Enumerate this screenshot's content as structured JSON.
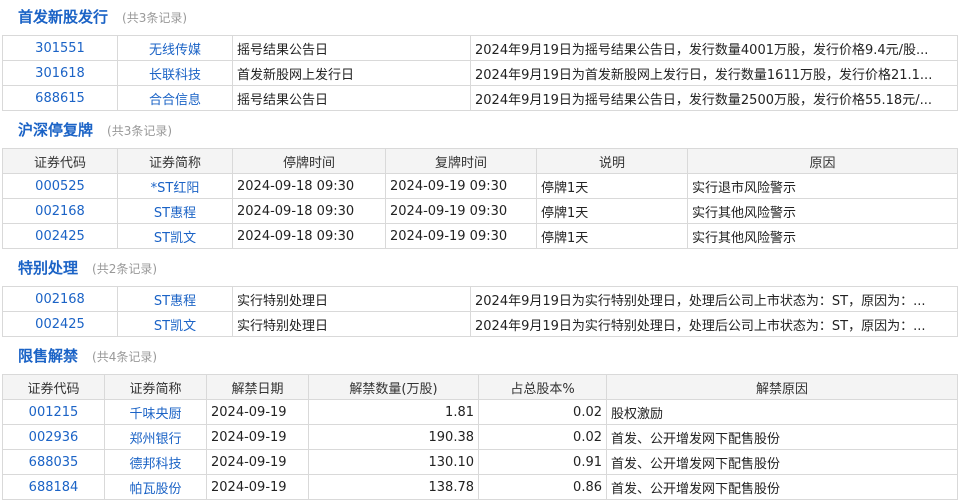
{
  "sec1": {
    "title": "首发新股发行",
    "count": "(共3条记录)",
    "rows": [
      [
        "301551",
        "无线传媒",
        "摇号结果公告日",
        "2024年9月19日为摇号结果公告日，发行数量4001万股，发行价格9.4元/股..."
      ],
      [
        "301618",
        "长联科技",
        "首发新股网上发行日",
        "2024年9月19日为首发新股网上发行日，发行数量1611万股，发行价格21.1..."
      ],
      [
        "688615",
        "合合信息",
        "摇号结果公告日",
        "2024年9月19日为摇号结果公告日，发行数量2500万股，发行价格55.18元/..."
      ]
    ]
  },
  "sec2": {
    "title": "沪深停复牌",
    "count": "(共3条记录)",
    "headers": [
      "证券代码",
      "证券简称",
      "停牌时间",
      "复牌时间",
      "说明",
      "原因"
    ],
    "rows": [
      [
        "000525",
        "*ST红阳",
        "2024-09-18 09:30",
        "2024-09-19 09:30",
        "停牌1天",
        "实行退市风险警示"
      ],
      [
        "002168",
        "ST惠程",
        "2024-09-18 09:30",
        "2024-09-19 09:30",
        "停牌1天",
        "实行其他风险警示"
      ],
      [
        "002425",
        "ST凯文",
        "2024-09-18 09:30",
        "2024-09-19 09:30",
        "停牌1天",
        "实行其他风险警示"
      ]
    ]
  },
  "sec3": {
    "title": "特别处理",
    "count": "(共2条记录)",
    "rows": [
      [
        "002168",
        "ST惠程",
        "实行特别处理日",
        "2024年9月19日为实行特别处理日，处理后公司上市状态为：ST，原因为：..."
      ],
      [
        "002425",
        "ST凯文",
        "实行特别处理日",
        "2024年9月19日为实行特别处理日，处理后公司上市状态为：ST，原因为：..."
      ]
    ]
  },
  "sec4": {
    "title": "限售解禁",
    "count": "(共4条记录)",
    "headers": [
      "证券代码",
      "证券简称",
      "解禁日期",
      "解禁数量(万股)",
      "占总股本%",
      "解禁原因"
    ],
    "rows": [
      [
        "001215",
        "千味央厨",
        "2024-09-19",
        "1.81",
        "0.02",
        "股权激励"
      ],
      [
        "002936",
        "郑州银行",
        "2024-09-19",
        "190.38",
        "0.02",
        "首发、公开增发网下配售股份"
      ],
      [
        "688035",
        "德邦科技",
        "2024-09-19",
        "130.10",
        "0.91",
        "首发、公开增发网下配售股份"
      ],
      [
        "688184",
        "帕瓦股份",
        "2024-09-19",
        "138.78",
        "0.86",
        "首发、公开增发网下配售股份"
      ]
    ]
  }
}
